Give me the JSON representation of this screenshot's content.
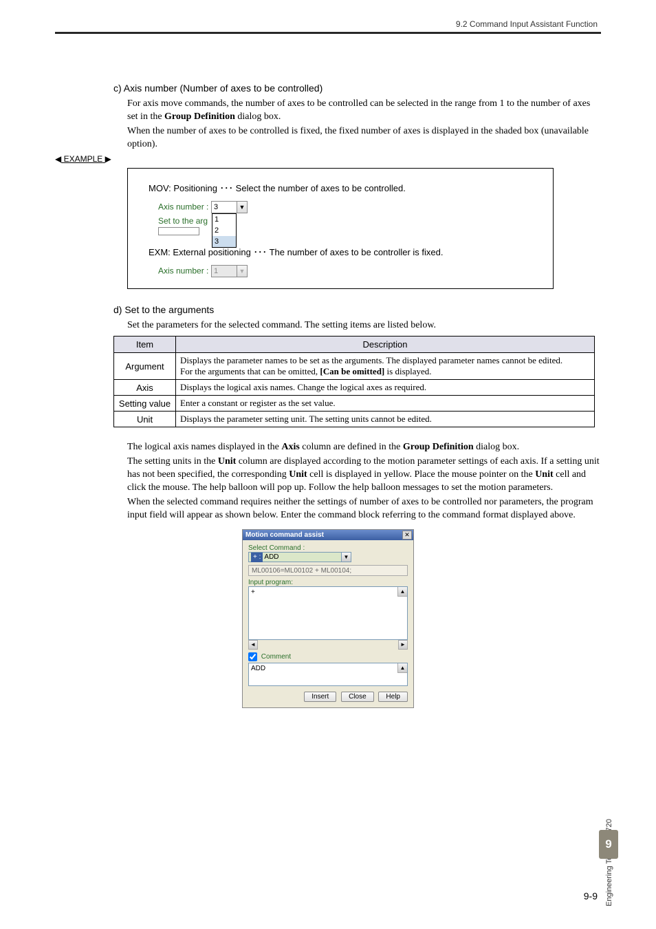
{
  "header": {
    "breadcrumb": "9.2  Command Input Assistant Function"
  },
  "section_c": {
    "title": "c) Axis number (Number of axes to be controlled)",
    "p1": "For axis move commands, the number of axes to be controlled can be selected in the range from 1 to the number of axes set in the Group Definition dialog box.",
    "p2": "When the number of axes to be controlled is fixed, the fixed number of axes is displayed in the shaded box (unavailable option)."
  },
  "example": {
    "tag": "EXAMPLE",
    "line1": "MOV: Positioning ･･･ Select the number of axes to be controlled.",
    "axis_label": "Axis number :",
    "combo1_value": "3",
    "options": [
      "1",
      "2",
      "3"
    ],
    "set_label": "Set to the arg",
    "line2": "EXM: External positioning ･･･ The number of axes to be controller is fixed.",
    "combo2_value": "1"
  },
  "section_d": {
    "title": "d) Set to the arguments",
    "intro": "Set the parameters for the selected command. The setting items are listed below."
  },
  "table": {
    "h1": "Item",
    "h2": "Description",
    "rows": [
      {
        "item": "Argument",
        "desc1": "Displays the parameter names to be set as the arguments. The displayed parameter names cannot be edited.",
        "desc2": "For the arguments that can be omitted, [Can be omitted] is displayed."
      },
      {
        "item": "Axis",
        "desc": "Displays the logical axis names. Change the logical axes as required."
      },
      {
        "item": "Setting value",
        "desc": "Enter a constant or register as the set value."
      },
      {
        "item": "Unit",
        "desc": "Displays the parameter setting unit. The setting units cannot be edited."
      }
    ]
  },
  "para2": {
    "p1": "The logical axis names displayed in the Axis column are defined in the Group Definition dialog box.",
    "p2": "The setting units in the Unit column are displayed according to the motion parameter settings of each axis. If a setting unit has not been specified, the corresponding Unit cell is displayed in yellow. Place the mouse pointer on the Unit cell and click the mouse. The help balloon will pop up. Follow the help balloon messages to set the motion parameters.",
    "p3": "When the selected command requires neither the settings of number of axes to be controlled nor parameters, the program input field will appear as shown below. Enter the command block referring to the command format displayed above."
  },
  "dialog": {
    "title": "Motion command assist",
    "select_label": "Select Command :",
    "select_prefix": "+ :",
    "select_value": "ADD",
    "cmd_format": "ML00106=ML00102 + ML00104;",
    "input_label": "Input program:",
    "input_value": "+",
    "comment_label": "Comment",
    "comment_checked": true,
    "comment_value": "ADD",
    "buttons": {
      "insert": "Insert",
      "close": "Close",
      "help": "Help"
    }
  },
  "footer": {
    "side": "Engineering Tool MPE720",
    "chapter": "9",
    "page": "9-9"
  }
}
